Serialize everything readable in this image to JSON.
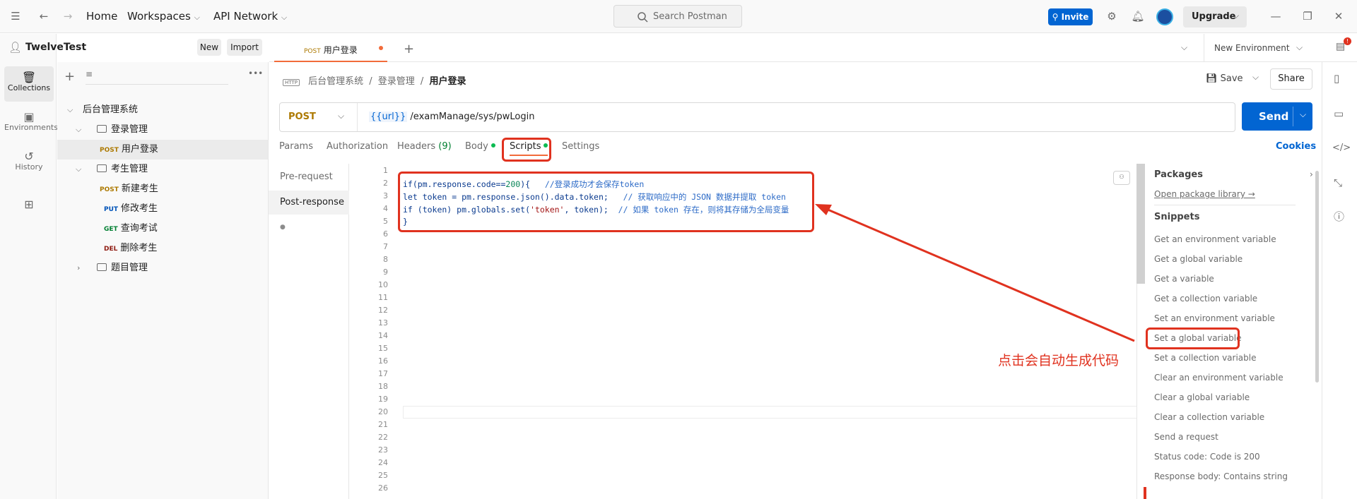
{
  "topbar": {
    "home": "Home",
    "workspaces": "Workspaces",
    "api_network": "API Network",
    "search_placeholder": "Search Postman",
    "invite": "Invite",
    "upgrade": "Upgrade",
    "notification_count": "!"
  },
  "workspace": {
    "name": "TwelveTest",
    "new_label": "New",
    "import_label": "Import"
  },
  "rail": [
    {
      "label": "Collections",
      "icon": "collections-icon"
    },
    {
      "label": "Environments",
      "icon": "environments-icon"
    },
    {
      "label": "History",
      "icon": "history-icon"
    }
  ],
  "tree": {
    "root": "后台管理系统",
    "folder1": "登录管理",
    "req_login": {
      "method": "POST",
      "name": "用户登录"
    },
    "folder2": "考生管理",
    "req_new": {
      "method": "POST",
      "name": "新建考生"
    },
    "req_edit": {
      "method": "PUT",
      "name": "修改考生"
    },
    "req_query": {
      "method": "GET",
      "name": "查询考试"
    },
    "req_delete": {
      "method": "DEL",
      "name": "删除考生"
    },
    "folder3": "题目管理"
  },
  "tab": {
    "method": "POST",
    "name": "用户登录"
  },
  "environment": "New Environment",
  "breadcrumb": {
    "part1": "后台管理系统",
    "sep": "/",
    "part2": "登录管理",
    "current": "用户登录"
  },
  "toolbar": {
    "save": "Save",
    "share": "Share"
  },
  "request": {
    "method": "POST",
    "url_var": "{{url}}",
    "url_path": "/examManage/sys/pwLogin",
    "send": "Send"
  },
  "request_tabs": {
    "params": "Params",
    "authorization": "Authorization",
    "headers": "Headers",
    "headers_count": "(9)",
    "body": "Body",
    "scripts": "Scripts",
    "settings": "Settings",
    "cookies": "Cookies"
  },
  "script_side": {
    "pre": "Pre-request",
    "post": "Post-response"
  },
  "code": {
    "l1_a": "if(pm.response.code==",
    "l1_num": "200",
    "l1_b": "){   ",
    "l1_comment": "//登录成功才会保存token",
    "l2_a": "let token = pm.response.json().data.token;   ",
    "l2_comment": "// 获取响应中的 JSON 数据并提取 token",
    "l3_a": "if (token) pm.globals.set(",
    "l3_str": "'token'",
    "l3_b": ", token);  ",
    "l3_comment": "// 如果 token 存在，则将其存储为全局变量",
    "l4": "}"
  },
  "line_numbers": [
    "1",
    "2",
    "3",
    "4",
    "5",
    "6",
    "7",
    "8",
    "9",
    "10",
    "11",
    "12",
    "13",
    "14",
    "15",
    "16",
    "17",
    "18",
    "19",
    "20",
    "21",
    "22",
    "23",
    "24",
    "25",
    "26"
  ],
  "snippets_panel": {
    "packages": "Packages",
    "open_library": "Open package library →",
    "snippets": "Snippets",
    "items": [
      "Get an environment variable",
      "Get a global variable",
      "Get a variable",
      "Get a collection variable",
      "Set an environment variable",
      "Set a global variable",
      "Set a collection variable",
      "Clear an environment variable",
      "Clear a global variable",
      "Clear a collection variable",
      "Send a request",
      "Status code: Code is 200",
      "Response body: Contains string"
    ]
  },
  "annotation": "点击会自动生成代码",
  "colors": {
    "accent_blue": "#0265d2",
    "annotation_red": "#e0321f",
    "post_orange": "#ad7a03"
  }
}
